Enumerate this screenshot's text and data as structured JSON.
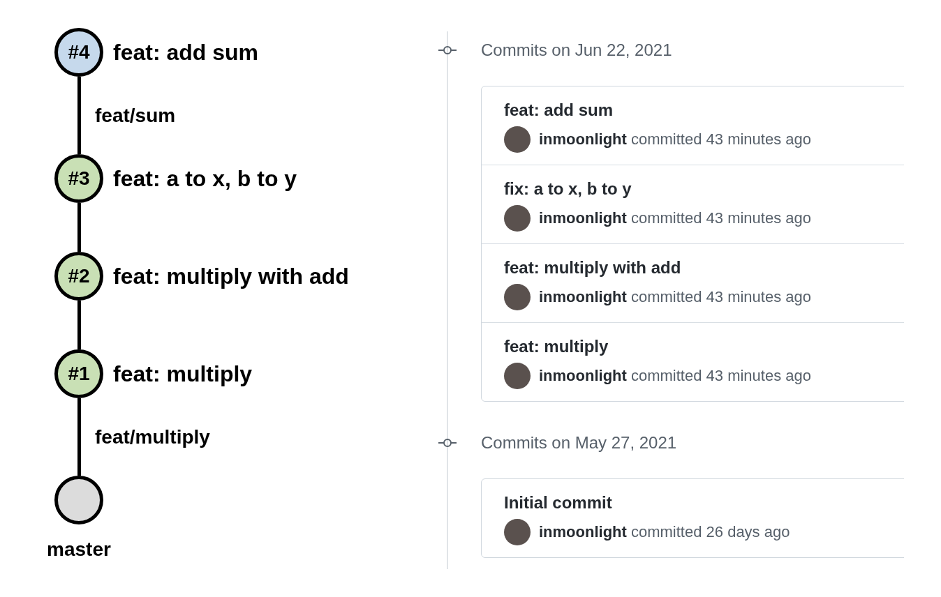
{
  "graph": {
    "items": [
      {
        "kind": "commit",
        "badge": "#4",
        "title": "feat: add sum",
        "color": "#c6d9ec"
      },
      {
        "kind": "edge",
        "label": "feat/sum"
      },
      {
        "kind": "commit",
        "badge": "#3",
        "title": "feat: a to x, b to y",
        "color": "#c9e0b5"
      },
      {
        "kind": "edge"
      },
      {
        "kind": "commit",
        "badge": "#2",
        "title": "feat: multiply with add",
        "color": "#c9e0b5"
      },
      {
        "kind": "edge"
      },
      {
        "kind": "commit",
        "badge": "#1",
        "title": "feat: multiply",
        "color": "#c9e0b5"
      },
      {
        "kind": "edge",
        "label": "feat/multiply"
      },
      {
        "kind": "base",
        "label": "master",
        "color": "#dcdcdc"
      }
    ]
  },
  "history": {
    "groups": [
      {
        "heading": "Commits on Jun 22, 2021",
        "commits": [
          {
            "title": "feat: add sum",
            "author": "inmoonlight",
            "action": "committed 43 minutes ago"
          },
          {
            "title": "fix: a to x, b to y",
            "author": "inmoonlight",
            "action": "committed 43 minutes ago"
          },
          {
            "title": "feat: multiply with add",
            "author": "inmoonlight",
            "action": "committed 43 minutes ago"
          },
          {
            "title": "feat: multiply",
            "author": "inmoonlight",
            "action": "committed 43 minutes ago"
          }
        ]
      },
      {
        "heading": "Commits on May 27, 2021",
        "commits": [
          {
            "title": "Initial commit",
            "author": "inmoonlight",
            "action": "committed 26 days ago"
          }
        ]
      }
    ]
  }
}
